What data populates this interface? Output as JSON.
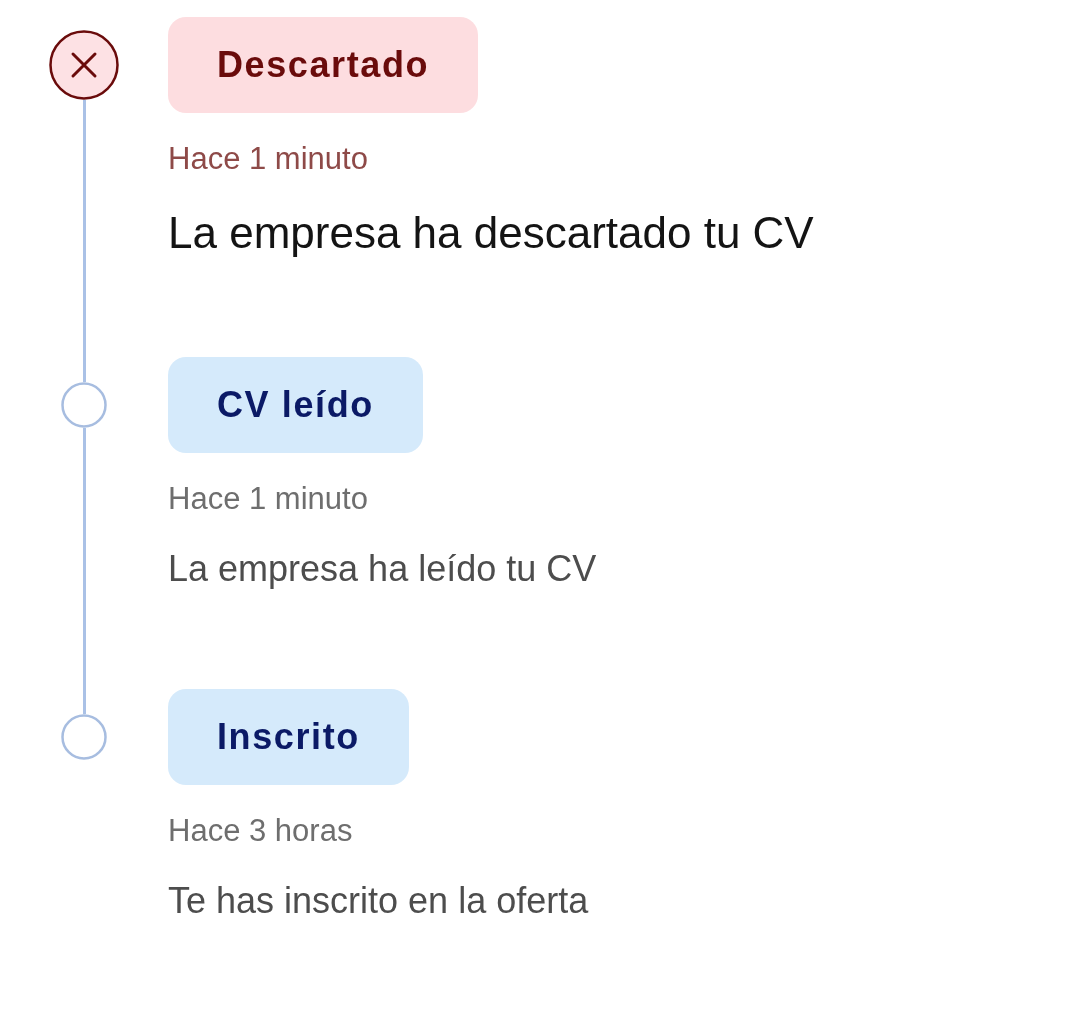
{
  "events": [
    {
      "kind": "rejected",
      "status": "Descartado",
      "time": "Hace 1 minuto",
      "description": "La empresa ha descartado tu CV"
    },
    {
      "kind": "step",
      "status": "CV leído",
      "time": "Hace 1 minuto",
      "description": "La empresa ha leído tu CV"
    },
    {
      "kind": "step",
      "status": "Inscrito",
      "time": "Hace 3 horas",
      "description": "Te has inscrito en la oferta"
    }
  ]
}
